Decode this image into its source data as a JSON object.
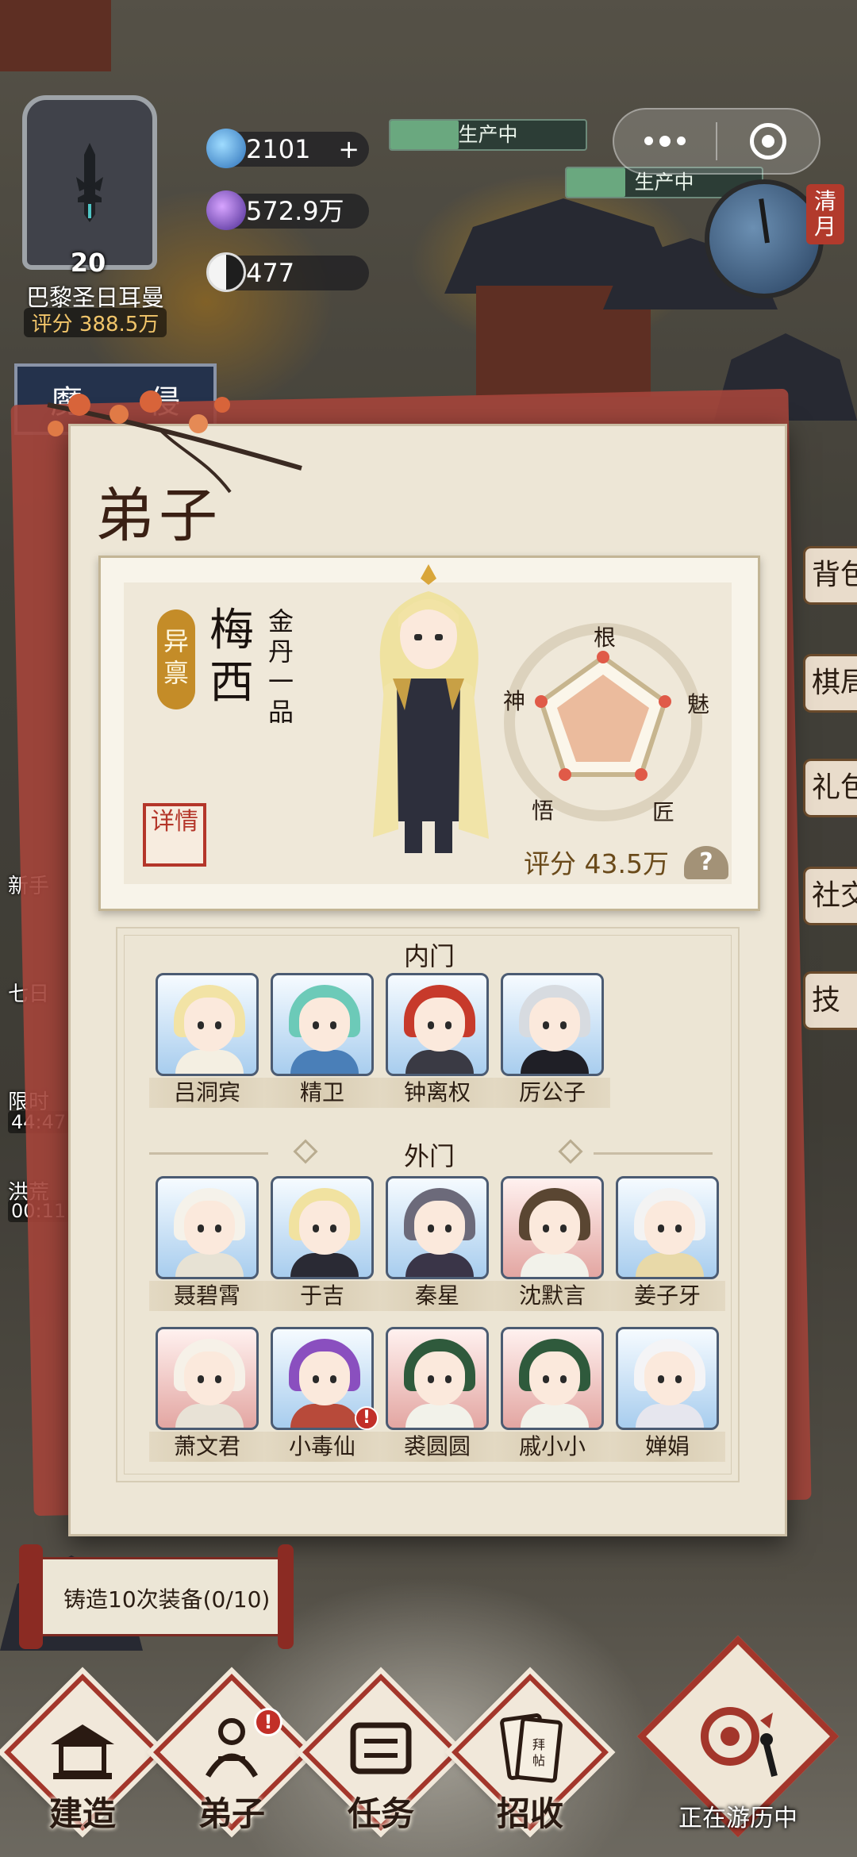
{
  "colors": {
    "accent_red": "#a3362b",
    "gold": "#c48c28",
    "paper": "#ede6d6",
    "production_green": "#71b487"
  },
  "player": {
    "level": "20",
    "name": "巴黎圣日耳曼",
    "score": "评分 388.5万"
  },
  "resources": [
    {
      "icon": "spirit-stone-icon",
      "value": "2101"
    },
    {
      "icon": "purple-gem-icon",
      "value": "572.9万"
    },
    {
      "icon": "yin-yang-icon",
      "value": "477"
    }
  ],
  "production": [
    {
      "label": "生产中",
      "progress": 0.35
    },
    {
      "label": "生产中",
      "progress": 0.3
    }
  ],
  "season": "清月",
  "demon_banner": [
    "魔",
    "侵"
  ],
  "left_labels": [
    "新手",
    "七日",
    "限时",
    "44:47",
    "洪荒",
    "00:11"
  ],
  "right_labels": [
    "背包",
    "棋局",
    "礼包",
    "社交",
    "技"
  ],
  "panel": {
    "title": "弟子",
    "featured": {
      "rarity": "异禀",
      "name": "梅西",
      "rank": "金丹一品",
      "detail_button": "详情",
      "stats": [
        "根",
        "魅",
        "匠",
        "悟",
        "神"
      ],
      "score": "评分 43.5万",
      "help": "?"
    },
    "inner_section_header": "内门",
    "inner_disciples": [
      {
        "name": "吕洞宾",
        "bg": "blue",
        "hair": "#f2e3a5",
        "robe": "#f4efe2"
      },
      {
        "name": "精卫",
        "bg": "blue",
        "hair": "#6ccab8",
        "robe": "#4a7fb8"
      },
      {
        "name": "钟离权",
        "bg": "blue",
        "hair": "#c73a2b",
        "robe": "#3a3a44"
      },
      {
        "name": "厉公子",
        "bg": "blue",
        "hair": "#d7dbe0",
        "robe": "#1f1f26"
      }
    ],
    "outer_section_header": "外门",
    "outer_disciples": [
      {
        "name": "聂碧霄",
        "bg": "blue",
        "hair": "#f5f2ea",
        "robe": "#e7e2d4"
      },
      {
        "name": "于吉",
        "bg": "blue",
        "hair": "#f1e2a0",
        "robe": "#2a2a34"
      },
      {
        "name": "秦星",
        "bg": "blue",
        "hair": "#6c6a7a",
        "robe": "#3a3548"
      },
      {
        "name": "沈默言",
        "bg": "red",
        "hair": "#5a4632",
        "robe": "#f2f2ea"
      },
      {
        "name": "姜子牙",
        "bg": "blue",
        "hair": "#f3f3f3",
        "robe": "#e8d9a8"
      },
      {
        "name": "萧文君",
        "bg": "red",
        "hair": "#f6f1e8",
        "robe": "#e8e2d6"
      },
      {
        "name": "小毒仙",
        "bg": "blue",
        "hair": "#8a4fbf",
        "robe": "#b84a3a",
        "alert": "!"
      },
      {
        "name": "裘圆圆",
        "bg": "red",
        "hair": "#2f5a3c",
        "robe": "#f2f2ea"
      },
      {
        "name": "戚小小",
        "bg": "red",
        "hair": "#2f5a3c",
        "robe": "#f2f2ea"
      },
      {
        "name": "婵娟",
        "bg": "blue",
        "hair": "#f4f4f6",
        "robe": "#e6e6ee"
      }
    ]
  },
  "quest": {
    "text": "铸造10次装备(0/10)"
  },
  "bottom_nav": [
    {
      "label": "建造",
      "icon": "pavilion-icon"
    },
    {
      "label": "弟子",
      "icon": "disciple-icon",
      "badge": "!"
    },
    {
      "label": "任务",
      "icon": "scroll-icon"
    },
    {
      "label": "招收",
      "icon": "invitation-card-icon",
      "card_text": "拜帖"
    }
  ],
  "travel": {
    "label": "正在游历中"
  },
  "miniprogram": {
    "menu_icon": "more-dots-icon",
    "close_icon": "target-close-icon"
  }
}
